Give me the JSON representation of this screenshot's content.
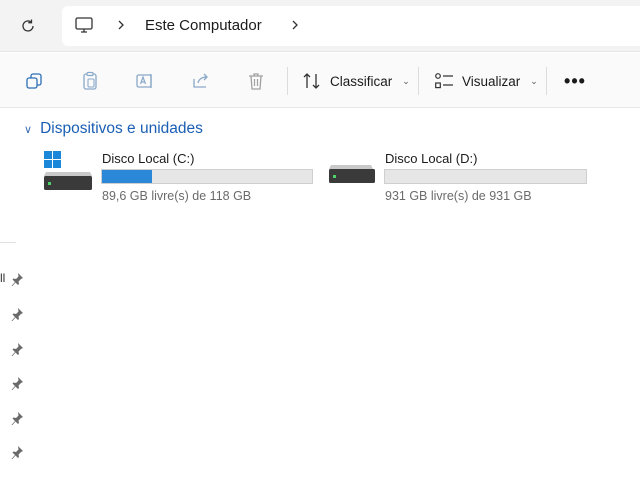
{
  "address_bar": {
    "breadcrumb": "Este Computador",
    "icons": [
      "refresh-icon",
      "computer-icon",
      "chevron-right-icon"
    ]
  },
  "command_bar": {
    "actions": [
      "copy-icon",
      "paste-icon",
      "rename-icon",
      "share-icon",
      "delete-icon"
    ],
    "sort_label": "Classificar",
    "view_label": "Visualizar",
    "more_label": "•••"
  },
  "section": {
    "title": "Dispositivos e unidades"
  },
  "drives": [
    {
      "name": "Disco Local (C:)",
      "info": "89,6 GB livre(s) de 118 GB",
      "used_fraction": 0.24,
      "icon": "windows-drive-icon"
    },
    {
      "name": "Disco Local (D:)",
      "info": "931 GB livre(s) de 931 GB",
      "used_fraction": 0.0,
      "icon": "drive-icon"
    }
  ],
  "nav_pane": {
    "partial_label": "ll",
    "pinned_count": 6
  },
  "colors": {
    "accent": "#2b88d8",
    "section_title": "#1a5fb4"
  }
}
